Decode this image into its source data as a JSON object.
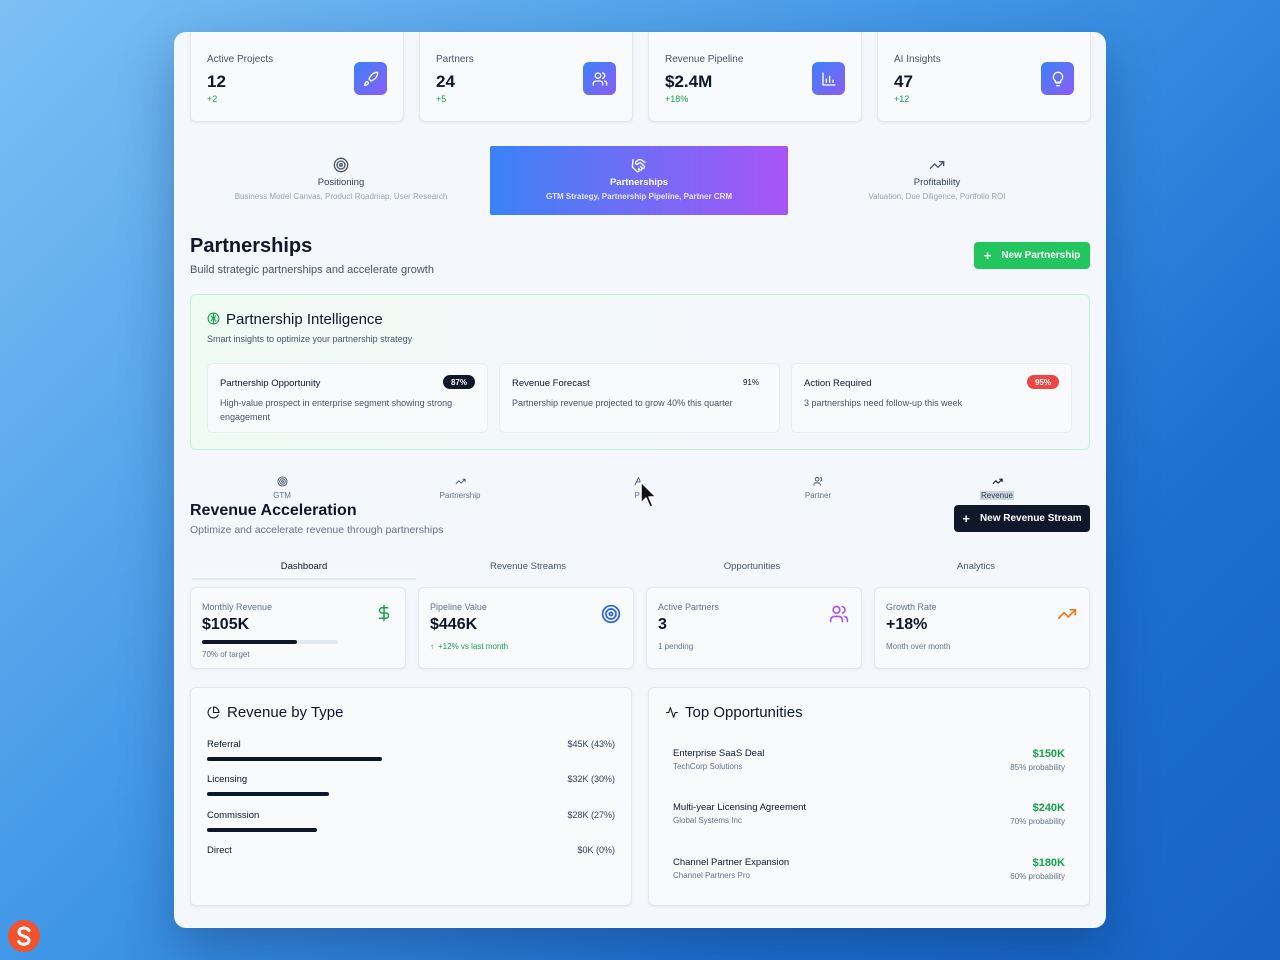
{
  "stats": [
    {
      "label": "Active Projects",
      "value": "12",
      "delta": "+2",
      "icon": "rocket-icon"
    },
    {
      "label": "Partners",
      "value": "24",
      "delta": "+5",
      "icon": "users-icon"
    },
    {
      "label": "Revenue Pipeline",
      "value": "$2.4M",
      "delta": "+18%",
      "icon": "bar-chart-icon"
    },
    {
      "label": "AI Insights",
      "value": "47",
      "delta": "+12",
      "icon": "lightbulb-icon"
    }
  ],
  "phases": [
    {
      "title": "Positioning",
      "subtitle": "Business Model Canvas, Product Roadmap, User Research",
      "icon": "target-icon"
    },
    {
      "title": "Partnerships",
      "subtitle": "GTM Strategy, Partnership Pipeline, Partner CRM",
      "icon": "handshake-icon",
      "active": true
    },
    {
      "title": "Profitability",
      "subtitle": "Valuation, Due Diligence, Portfolio ROI",
      "icon": "trending-up-icon"
    }
  ],
  "header": {
    "title": "Partnerships",
    "subtitle": "Build strategic partnerships and accelerate growth",
    "new_button": "New Partnership"
  },
  "intelligence": {
    "title": "Partnership Intelligence",
    "subtitle": "Smart insights to optimize your partnership strategy",
    "cards": [
      {
        "title": "Partnership Opportunity",
        "badge": "87%",
        "text": "High-value prospect in enterprise segment showing strong engagement"
      },
      {
        "title": "Revenue Forecast",
        "badge": "91%",
        "text": "Partnership revenue projected to grow 40% this quarter"
      },
      {
        "title": "Action Required",
        "badge": "95%",
        "text": "3 partnerships need follow-up this week"
      }
    ]
  },
  "subnav": [
    {
      "label": "GTM",
      "icon": "target-icon"
    },
    {
      "label": "Partnership",
      "icon": "trending-up-icon"
    },
    {
      "label": "Pi",
      "icon": "pipeline-icon"
    },
    {
      "label": "Partner",
      "icon": "users-icon"
    },
    {
      "label": "Revenue",
      "icon": "trending-up-icon"
    }
  ],
  "revenue": {
    "title": "Revenue Acceleration",
    "subtitle": "Optimize and accelerate revenue through partnerships",
    "new_button": "New Revenue Stream"
  },
  "tabs": [
    "Dashboard",
    "Revenue Streams",
    "Opportunities",
    "Analytics"
  ],
  "kpis": [
    {
      "label": "Monthly Revenue",
      "value": "$105K",
      "sub": "70% of target",
      "progress": 0.7,
      "icon": "dollar-icon",
      "color": "#16a34a"
    },
    {
      "label": "Pipeline Value",
      "value": "$446K",
      "sub": "+12% vs last month",
      "icon": "target-icon",
      "color": "#2563eb"
    },
    {
      "label": "Active Partners",
      "value": "3",
      "sub": "1 pending",
      "icon": "users-icon",
      "color": "#a855f7"
    },
    {
      "label": "Growth Rate",
      "value": "+18%",
      "sub": "Month over month",
      "icon": "trending-up-icon",
      "color": "#f97316"
    }
  ],
  "by_type": {
    "title": "Revenue by Type",
    "rows": [
      {
        "label": "Referral",
        "value": "$45K (43%)",
        "share": 0.43
      },
      {
        "label": "Licensing",
        "value": "$32K (30%)",
        "share": 0.3
      },
      {
        "label": "Commission",
        "value": "$28K (27%)",
        "share": 0.27
      },
      {
        "label": "Direct",
        "value": "$0K (0%)",
        "share": 0
      }
    ]
  },
  "opportunities": {
    "title": "Top Opportunities",
    "items": [
      {
        "name": "Enterprise SaaS Deal",
        "company": "TechCorp Solutions",
        "amount": "$150K",
        "probability": "85% probability"
      },
      {
        "name": "Multi-year Licensing Agreement",
        "company": "Global Systems Inc",
        "amount": "$240K",
        "probability": "70% probability"
      },
      {
        "name": "Channel Partner Expansion",
        "company": "Channel Partners Pro",
        "amount": "$180K",
        "probability": "60% probability"
      }
    ]
  },
  "colors": {
    "accent_green": "#22c55e",
    "accent_gradient_from": "#3b82f6",
    "accent_gradient_to": "#a855f7",
    "dark": "#0f172a",
    "badge_red": "#ef4444"
  }
}
